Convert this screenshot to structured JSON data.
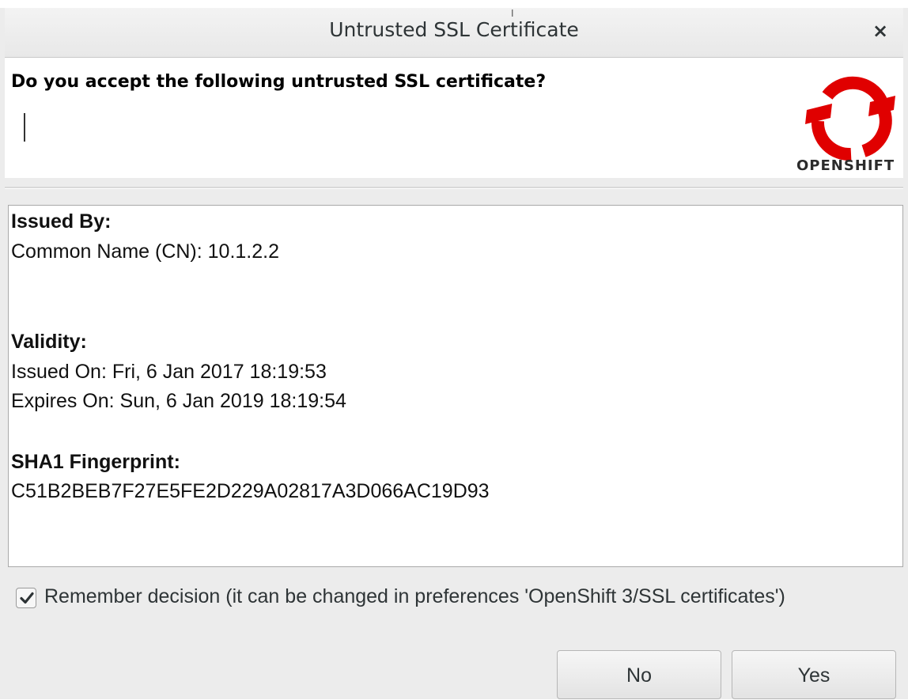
{
  "window": {
    "title": "Untrusted SSL Certificate",
    "close_glyph": "×",
    "close_icon": "close-icon"
  },
  "header": {
    "question": "Do you accept the following untrusted SSL certificate?",
    "logo_text": "OPENSHIFT",
    "logo_icon": "openshift-logo",
    "logo_color": "#e00000"
  },
  "certificate": {
    "issued_by_heading": "Issued By:",
    "common_name": "Common Name (CN): 10.1.2.2",
    "validity_heading": "Validity:",
    "issued_on": "Issued On: Fri, 6 Jan 2017 18:19:53",
    "expires_on": "Expires On: Sun, 6 Jan 2019 18:19:54",
    "fingerprint_heading": "SHA1 Fingerprint:",
    "fingerprint": "C51B2BEB7F27E5FE2D229A02817A3D066AC19D93"
  },
  "remember": {
    "checked": true,
    "label": "Remember decision (it can be changed in preferences 'OpenShift 3/SSL certificates')"
  },
  "buttons": {
    "no_label": "No",
    "yes_label": "Yes"
  }
}
